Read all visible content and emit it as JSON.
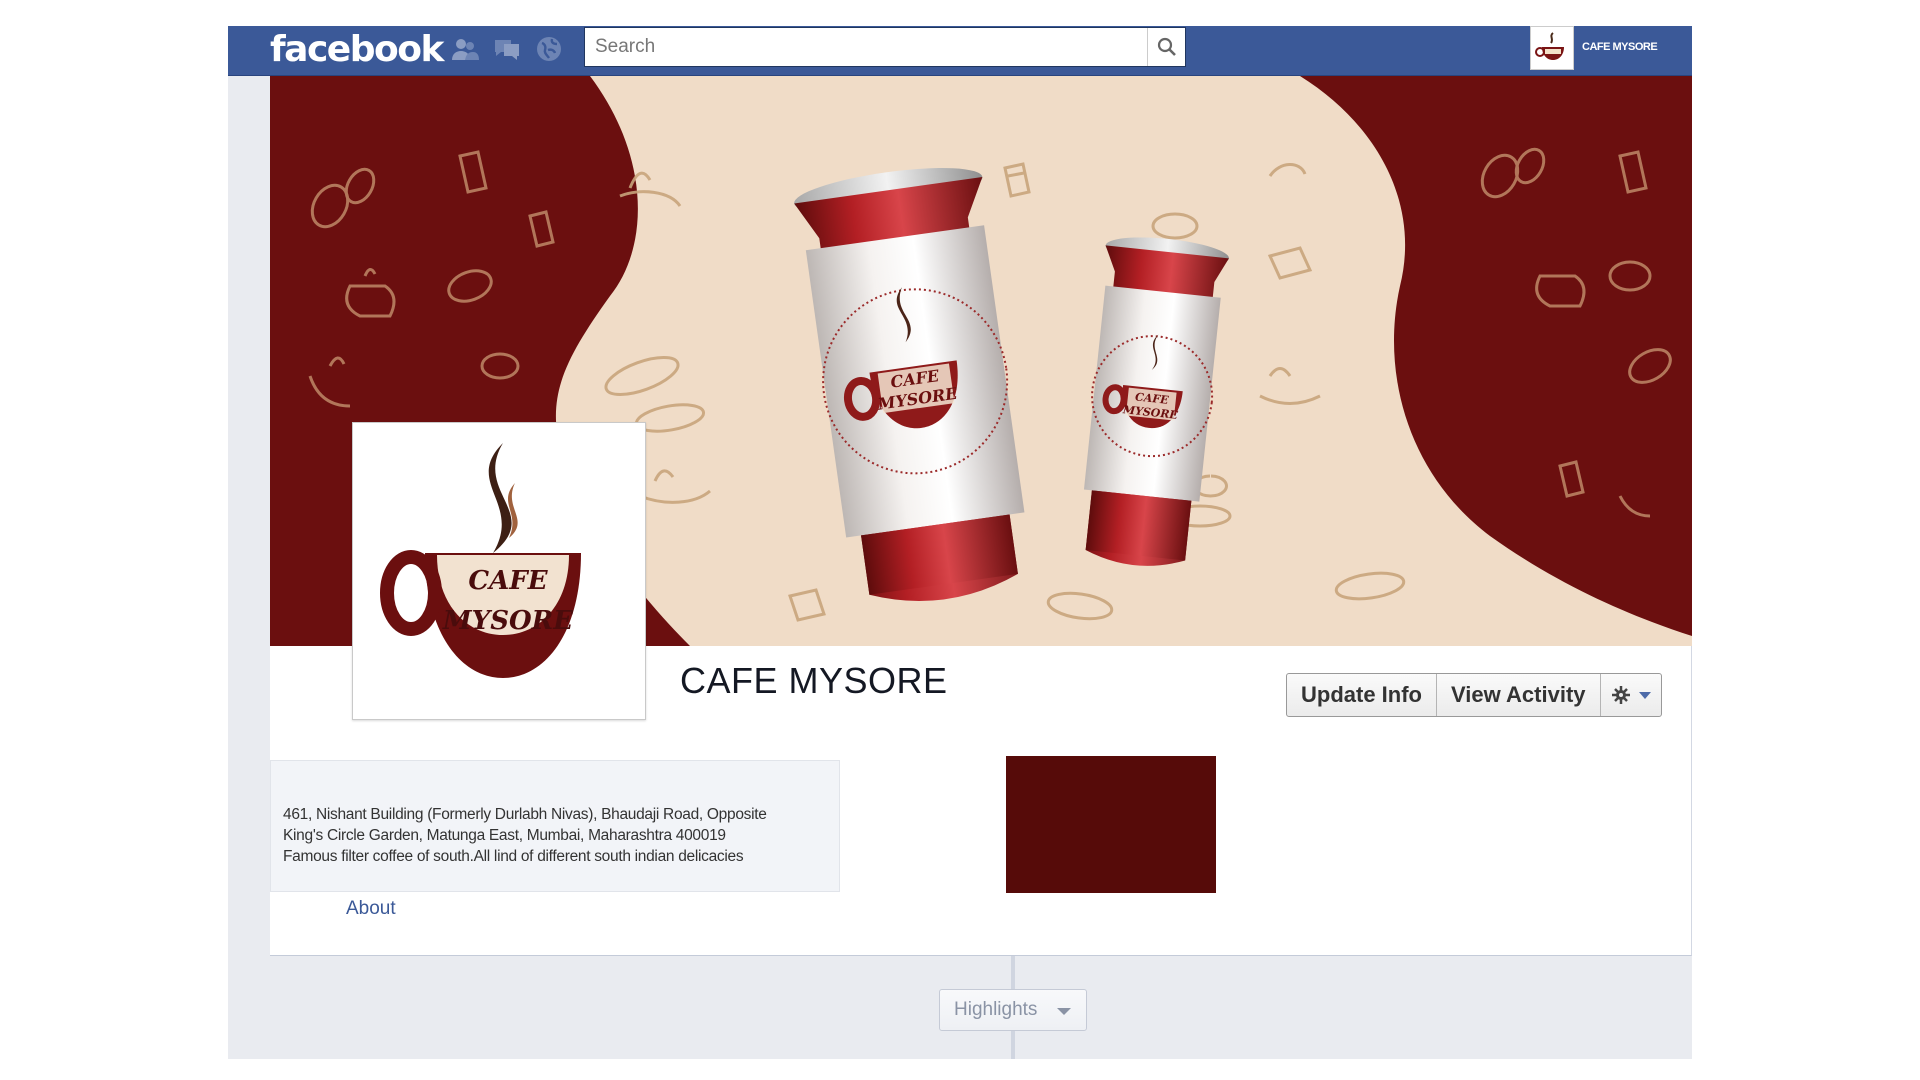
{
  "topbar": {
    "logo": "facebook",
    "search_placeholder": "Search",
    "jewels": [
      "friend-requests-icon",
      "messages-icon",
      "notifications-icon"
    ],
    "profile_name": "CAFE MYSORE"
  },
  "cover": {
    "brand_line1": "CAFE",
    "brand_line2": "MYSORE"
  },
  "profile_pic": {
    "line1": "CAFE",
    "line2": "MYSORE"
  },
  "page": {
    "title": "CAFE MYSORE"
  },
  "actions": {
    "update_info": "Update Info",
    "view_activity": "View Activity"
  },
  "about": {
    "line1": "461, Nishant Building (Formerly Durlabh Nivas), Bhaudaji Road, Opposite",
    "line2": "King's Circle Garden, Matunga East, Mumbai, Maharashtra 400019",
    "line3": "Famous filter coffee of south.All lind of different south indian delicacies",
    "link_label": "About"
  },
  "highlights": {
    "label": "Highlights"
  },
  "colors": {
    "facebook_blue": "#3b5998",
    "brand_maroon": "#6b0f0f",
    "cream": "#f0dcc7",
    "map_tile": "#560b09"
  }
}
